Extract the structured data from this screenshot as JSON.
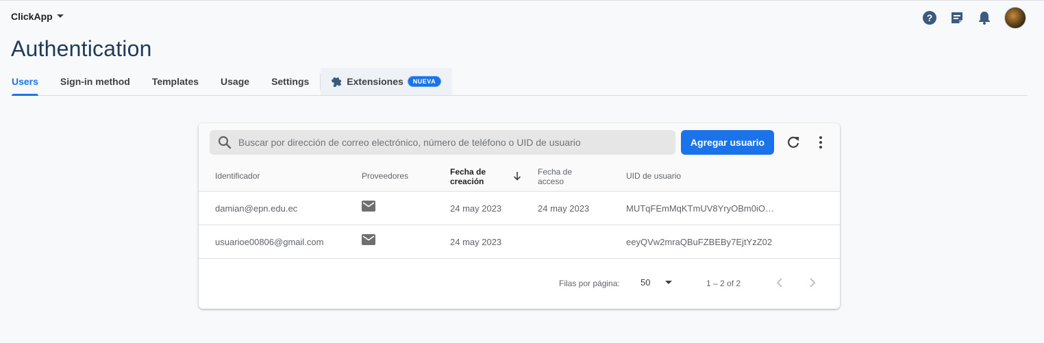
{
  "header": {
    "project_name": "ClickApp",
    "icons": [
      "help-icon",
      "release-notes-icon",
      "notifications-icon",
      "avatar"
    ]
  },
  "page": {
    "title": "Authentication"
  },
  "tabs": [
    {
      "label": "Users",
      "active": true
    },
    {
      "label": "Sign-in method"
    },
    {
      "label": "Templates"
    },
    {
      "label": "Usage"
    },
    {
      "label": "Settings"
    },
    {
      "label": "Extensiones",
      "badge": "NUEVA"
    }
  ],
  "toolbar": {
    "search_placeholder": "Buscar por dirección de correo electrónico, número de teléfono o UID de usuario",
    "add_user_label": "Agregar usuario"
  },
  "table": {
    "columns": {
      "identifier": "Identificador",
      "providers": "Proveedores",
      "created_line1": "Fecha de",
      "created_line2": "creación",
      "access_line1": "Fecha de",
      "access_line2": "acceso",
      "uid": "UID de usuario"
    },
    "rows": [
      {
        "identifier": "damian@epn.edu.ec",
        "provider": "email",
        "created": "24 may 2023",
        "accessed": "24 may 2023",
        "uid": "MUTqFEmMqKTmUV8YryOBm0iO…"
      },
      {
        "identifier": "usuarioe00806@gmail.com",
        "provider": "email",
        "created": "24 may 2023",
        "accessed": "",
        "uid": "eeyQVw2mraQBuFZBEBy7EjtYzZ02"
      }
    ]
  },
  "pagination": {
    "rows_per_page_label": "Filas por página:",
    "rows_per_page_value": "50",
    "range": "1 – 2 of 2"
  },
  "colors": {
    "accent": "#1a73e8",
    "title": "#1f3b57"
  }
}
